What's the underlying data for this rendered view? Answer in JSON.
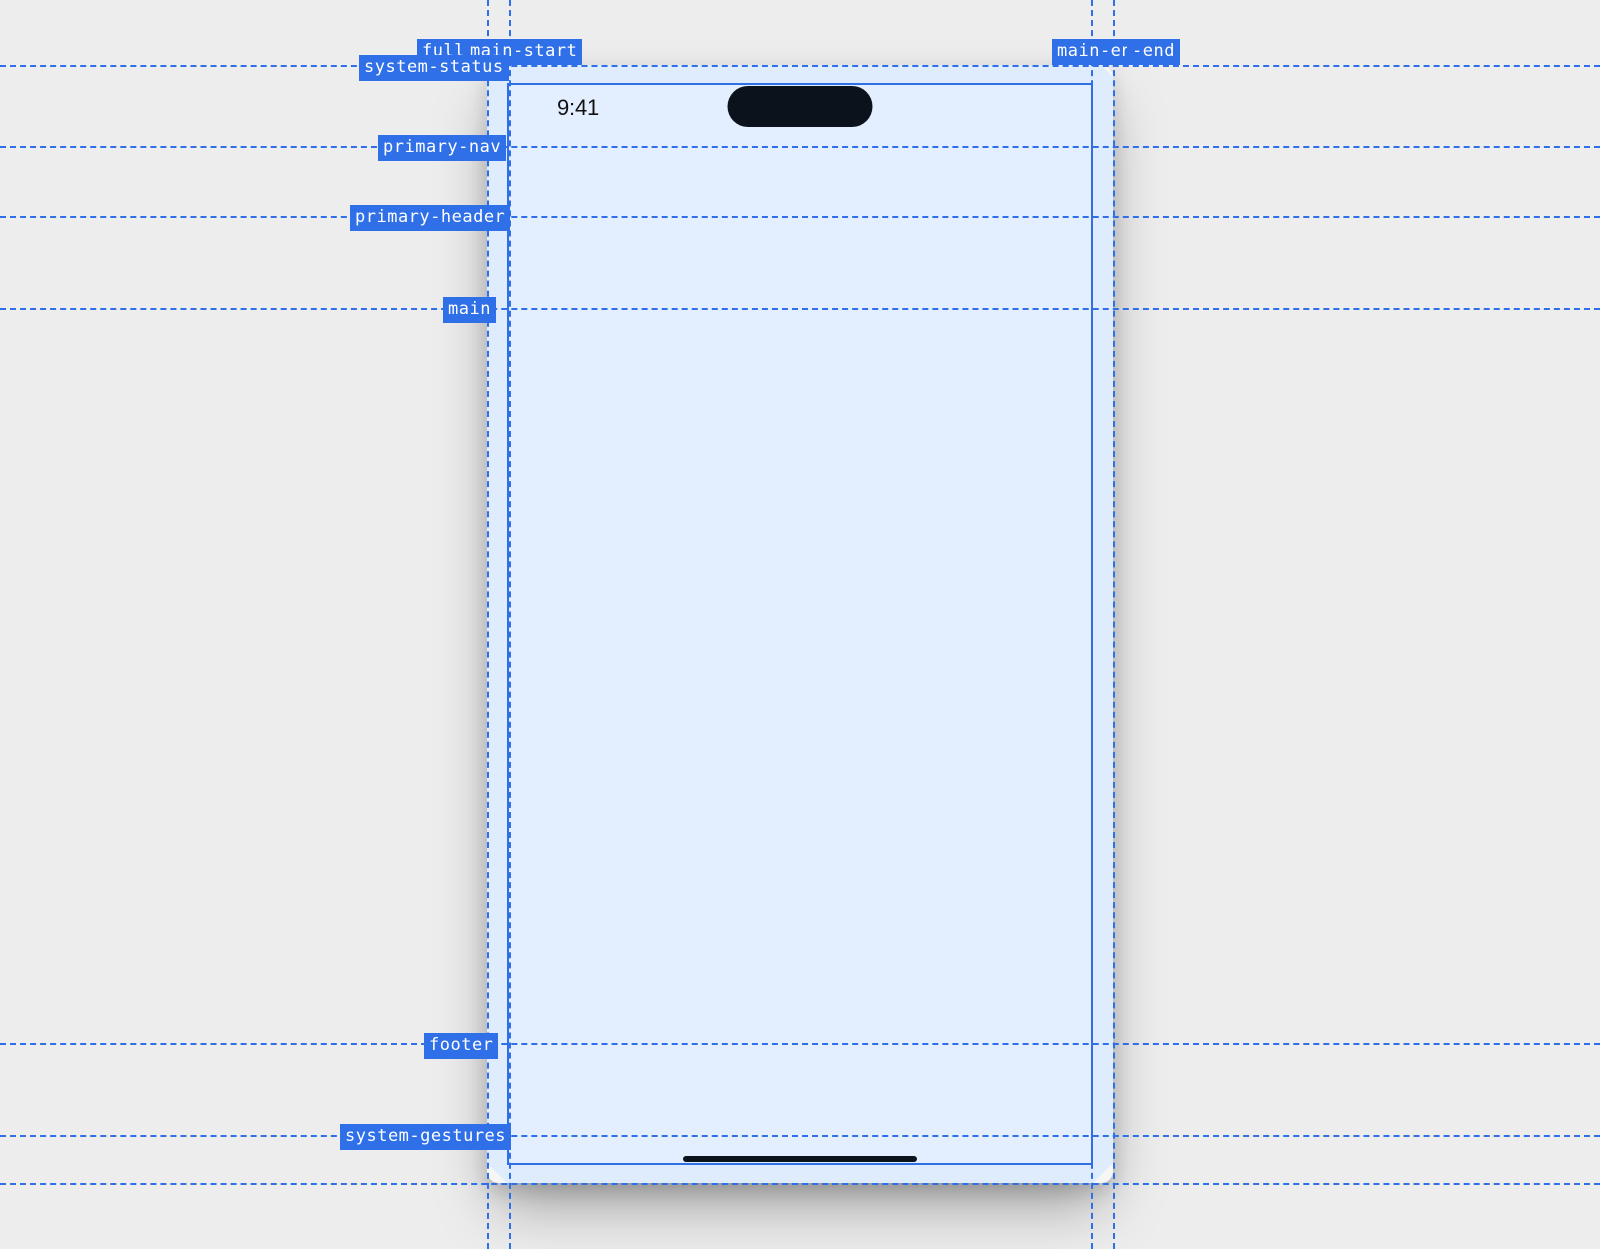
{
  "status": {
    "time": "9:41"
  },
  "guides": {
    "vertical": {
      "fullbleed_start": "fullbleed",
      "main_start": "main-start",
      "main_end": "main-end",
      "fullbleed_end": "-end"
    },
    "horizontal": {
      "system_status": "system-status",
      "primary_nav": "primary-nav",
      "primary_header": "primary-header",
      "main": "main",
      "footer": "footer",
      "system_gestures": "system-gestures"
    }
  }
}
